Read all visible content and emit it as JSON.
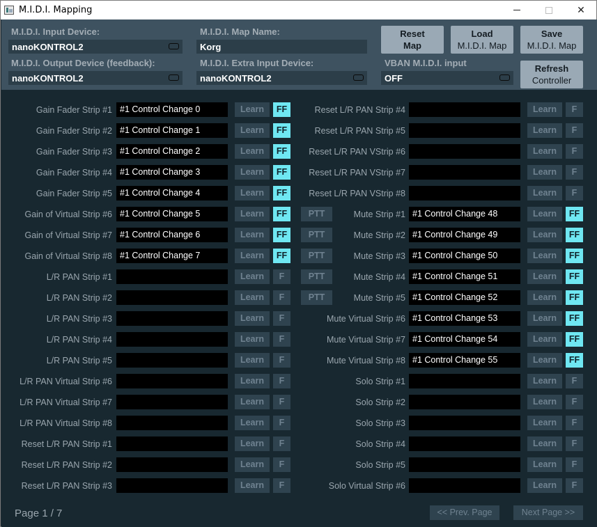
{
  "window": {
    "title": "M.I.D.I. Mapping",
    "minimize_icon": "minimize-icon",
    "maximize_icon": "maximize-icon",
    "close_icon": "close-icon",
    "close_glyph": "✕"
  },
  "devices": {
    "input_label": "M.I.D.I. Input Device:",
    "input_value": "nanoKONTROL2",
    "output_label": "M.I.D.I. Output Device (feedback):",
    "output_value": "nanoKONTROL2",
    "map_name_label": "M.I.D.I. Map Name:",
    "map_name_value": "Korg",
    "extra_input_label": "M.I.D.I. Extra Input Device:",
    "extra_input_value": "nanoKONTROL2",
    "vban_label": "VBAN M.I.D.I. input",
    "vban_value": "OFF"
  },
  "buttons": {
    "reset_line1": "Reset",
    "reset_line2": "Map",
    "load_line1": "Load",
    "load_line2": "M.I.D.I. Map",
    "save_line1": "Save",
    "save_line2": "M.I.D.I. Map",
    "refresh_line1": "Refresh",
    "refresh_line2": "Controller",
    "learn": "Learn",
    "ff_on": "FF",
    "ff_off": "F",
    "ptt": "PTT"
  },
  "left_rows": [
    {
      "label": "Gain Fader Strip #1",
      "value": "#1 Control Change 0",
      "ff": "FF",
      "ff_on": true,
      "ptt": false
    },
    {
      "label": "Gain Fader Strip #2",
      "value": "#1 Control Change 1",
      "ff": "FF",
      "ff_on": true,
      "ptt": false
    },
    {
      "label": "Gain Fader Strip #3",
      "value": "#1 Control Change 2",
      "ff": "FF",
      "ff_on": true,
      "ptt": false
    },
    {
      "label": "Gain Fader Strip #4",
      "value": "#1 Control Change 3",
      "ff": "FF",
      "ff_on": true,
      "ptt": false
    },
    {
      "label": "Gain Fader Strip #5",
      "value": "#1 Control Change 4",
      "ff": "FF",
      "ff_on": true,
      "ptt": false
    },
    {
      "label": "Gain of Virtual Strip #6",
      "value": "#1 Control Change 5",
      "ff": "FF",
      "ff_on": true,
      "ptt": true
    },
    {
      "label": "Gain of Virtual Strip #7",
      "value": "#1 Control Change 6",
      "ff": "FF",
      "ff_on": true,
      "ptt": true
    },
    {
      "label": "Gain of Virtual Strip #8",
      "value": "#1 Control Change 7",
      "ff": "FF",
      "ff_on": true,
      "ptt": true
    },
    {
      "label": "L/R PAN Strip #1",
      "value": "",
      "ff": "F",
      "ff_on": false,
      "ptt": true
    },
    {
      "label": "L/R PAN Strip #2",
      "value": "",
      "ff": "F",
      "ff_on": false,
      "ptt": true
    },
    {
      "label": "L/R PAN Strip #3",
      "value": "",
      "ff": "F",
      "ff_on": false,
      "ptt": false
    },
    {
      "label": "L/R PAN Strip #4",
      "value": "",
      "ff": "F",
      "ff_on": false,
      "ptt": false
    },
    {
      "label": "L/R PAN Strip #5",
      "value": "",
      "ff": "F",
      "ff_on": false,
      "ptt": false
    },
    {
      "label": "L/R PAN Virtual Strip #6",
      "value": "",
      "ff": "F",
      "ff_on": false,
      "ptt": false
    },
    {
      "label": "L/R PAN Virtual Strip #7",
      "value": "",
      "ff": "F",
      "ff_on": false,
      "ptt": false
    },
    {
      "label": "L/R PAN Virtual Strip #8",
      "value": "",
      "ff": "F",
      "ff_on": false,
      "ptt": false
    },
    {
      "label": "Reset L/R PAN Strip #1",
      "value": "",
      "ff": "F",
      "ff_on": false,
      "ptt": false
    },
    {
      "label": "Reset L/R PAN Strip #2",
      "value": "",
      "ff": "F",
      "ff_on": false,
      "ptt": false
    },
    {
      "label": "Reset L/R PAN Strip #3",
      "value": "",
      "ff": "F",
      "ff_on": false,
      "ptt": false
    }
  ],
  "right_rows": [
    {
      "label": "Reset L/R PAN Strip #4",
      "value": "",
      "ff": "F",
      "ff_on": false
    },
    {
      "label": "Reset L/R PAN Strip #5",
      "value": "",
      "ff": "F",
      "ff_on": false
    },
    {
      "label": "Reset L/R PAN VStrip #6",
      "value": "",
      "ff": "F",
      "ff_on": false
    },
    {
      "label": "Reset L/R PAN VStrip #7",
      "value": "",
      "ff": "F",
      "ff_on": false
    },
    {
      "label": "Reset L/R PAN VStrip #8",
      "value": "",
      "ff": "F",
      "ff_on": false
    },
    {
      "label": "Mute Strip #1",
      "value": "#1 Control Change 48",
      "ff": "FF",
      "ff_on": true
    },
    {
      "label": "Mute Strip #2",
      "value": "#1 Control Change 49",
      "ff": "FF",
      "ff_on": true
    },
    {
      "label": "Mute Strip #3",
      "value": "#1 Control Change 50",
      "ff": "FF",
      "ff_on": true
    },
    {
      "label": "Mute Strip #4",
      "value": "#1 Control Change 51",
      "ff": "FF",
      "ff_on": true
    },
    {
      "label": "Mute Strip #5",
      "value": "#1 Control Change 52",
      "ff": "FF",
      "ff_on": true
    },
    {
      "label": "Mute Virtual Strip #6",
      "value": "#1 Control Change 53",
      "ff": "FF",
      "ff_on": true
    },
    {
      "label": "Mute Virtual Strip #7",
      "value": "#1 Control Change 54",
      "ff": "FF",
      "ff_on": true
    },
    {
      "label": "Mute Virtual Strip #8",
      "value": "#1 Control Change 55",
      "ff": "FF",
      "ff_on": true
    },
    {
      "label": "Solo Strip #1",
      "value": "",
      "ff": "F",
      "ff_on": false
    },
    {
      "label": "Solo Strip #2",
      "value": "",
      "ff": "F",
      "ff_on": false
    },
    {
      "label": "Solo Strip #3",
      "value": "",
      "ff": "F",
      "ff_on": false
    },
    {
      "label": "Solo Strip #4",
      "value": "",
      "ff": "F",
      "ff_on": false
    },
    {
      "label": "Solo Strip #5",
      "value": "",
      "ff": "F",
      "ff_on": false
    },
    {
      "label": "Solo Virtual Strip #6",
      "value": "",
      "ff": "F",
      "ff_on": false
    }
  ],
  "footer": {
    "page": "Page 1 / 7",
    "prev": "<< Prev. Page",
    "next": "Next Page >>"
  },
  "colors": {
    "ff_active": "#6fe7f2",
    "top_panel": "#3e5260",
    "grid_bg": "#182830"
  }
}
